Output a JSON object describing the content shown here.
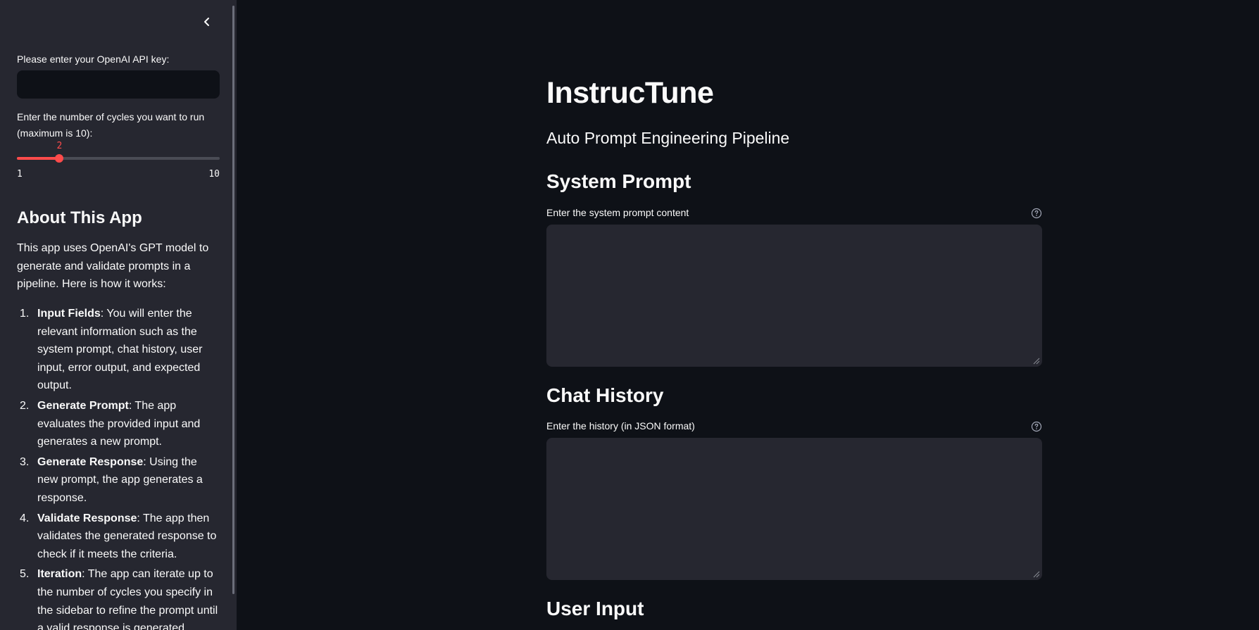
{
  "sidebar": {
    "collapse_icon": "chevron-left-icon",
    "api_key_label": "Please enter your OpenAI API key:",
    "api_key_value": "",
    "cycles_label": "Enter the number of cycles you want to run (maximum is 10):",
    "slider": {
      "value": "2",
      "value_num": 2,
      "min": "1",
      "max": "10",
      "min_num": 1,
      "max_num": 10,
      "accent": "#ff4b4b"
    },
    "about_title": "About This App",
    "about_intro": "This app uses OpenAI's GPT model to generate and validate prompts in a pipeline. Here is how it works:",
    "steps": [
      {
        "num": "1.",
        "bold": "Input Fields",
        "text": ": You will enter the relevant information such as the system prompt, chat history, user input, error output, and expected output."
      },
      {
        "num": "2.",
        "bold": "Generate Prompt",
        "text": ": The app evaluates the provided input and generates a new prompt."
      },
      {
        "num": "3.",
        "bold": "Generate Response",
        "text": ": Using the new prompt, the app generates a response."
      },
      {
        "num": "4.",
        "bold": "Validate Response",
        "text": ": The app then validates the generated response to check if it meets the criteria."
      },
      {
        "num": "5.",
        "bold": "Iteration",
        "text": ": The app can iterate up to the number of cycles you specify in the sidebar to refine the prompt until a valid response is generated."
      }
    ]
  },
  "main": {
    "title": "InstrucTune",
    "subtitle": "Auto Prompt Engineering Pipeline",
    "system_prompt": {
      "heading": "System Prompt",
      "label": "Enter the system prompt content",
      "value": "",
      "help_icon": "question-circle-icon"
    },
    "chat_history": {
      "heading": "Chat History",
      "label": "Enter the history (in JSON format)",
      "value": "",
      "help_icon": "question-circle-icon"
    },
    "user_input": {
      "heading": "User Input"
    }
  },
  "colors": {
    "background": "#0e1117",
    "sidebar": "#262730",
    "input_bg": "#262730",
    "accent": "#ff4b4b",
    "text": "#fafafa"
  }
}
